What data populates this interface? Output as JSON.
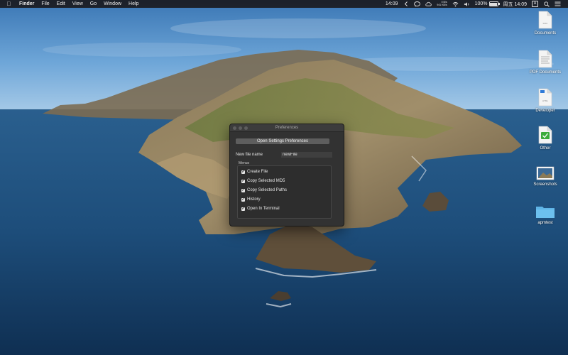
{
  "menubar": {
    "apple_icon": "apple-logo-icon",
    "app_name": "Finder",
    "menus": [
      "File",
      "Edit",
      "View",
      "Go",
      "Window",
      "Help"
    ],
    "clock_short": "14:09",
    "network_up": "0 B/s",
    "network_down": "941 KB/s",
    "battery_percent": "100%",
    "battery_level": 1.0,
    "datetime": "周五 14:09",
    "user_initial": "A"
  },
  "desktop_icons": [
    {
      "label": "Documents",
      "icon": "document-file-icon"
    },
    {
      "label": "PDF Documents",
      "icon": "pdf-document-icon"
    },
    {
      "label": "Developer",
      "icon": "html-document-icon"
    },
    {
      "label": "Other",
      "icon": "checked-document-icon"
    },
    {
      "label": "Screenshots",
      "icon": "screenshot-image-icon"
    },
    {
      "label": "apmtest",
      "icon": "folder-icon"
    }
  ],
  "prefs": {
    "title": "Preferences",
    "open_settings_label": "Open Settings Preferences",
    "new_file_label": "New file name",
    "new_file_value": "newFile",
    "menus_group_title": "Menus",
    "menu_options": [
      {
        "label": "Create File",
        "checked": true
      },
      {
        "label": "Copy Selected MD5",
        "checked": true
      },
      {
        "label": "Copy Selected Paths",
        "checked": true
      },
      {
        "label": "History",
        "checked": true
      },
      {
        "label": "Open In Terminal",
        "checked": true
      }
    ]
  },
  "colors": {
    "accent": "#0b84ff",
    "window_bg": "#323232",
    "menubar_bg": "#1a1a1e"
  }
}
